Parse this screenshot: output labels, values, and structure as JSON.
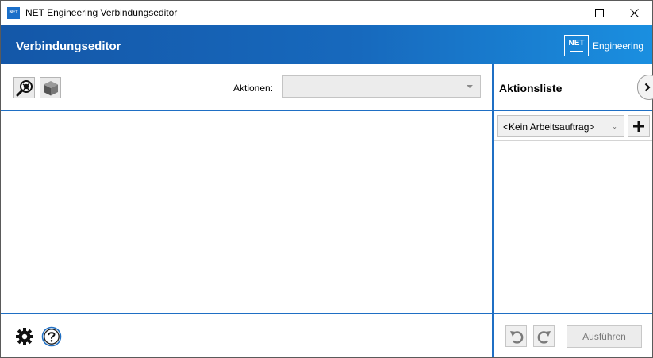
{
  "window": {
    "title": "NET Engineering Verbindungseditor",
    "icon_text": "NET",
    "controls": [
      "minimize-icon",
      "maximize-icon",
      "close-icon"
    ]
  },
  "header": {
    "title": "Verbindungseditor",
    "brand_mark": "NET",
    "brand_text": "Engineering",
    "gradient_colors": [
      "#1457a8",
      "#1a8fe0"
    ]
  },
  "toolbar": {
    "buttons": [
      {
        "icon": "network-search-icon"
      },
      {
        "icon": "cube-icon"
      }
    ],
    "actions_label": "Aktionen:",
    "actions_value": ""
  },
  "action_panel": {
    "title": "Aktionsliste",
    "toggle_icon": "chevron-right-icon",
    "work_order_value": "<Kein Arbeitsauftrag>",
    "add_icon": "plus-icon",
    "items": []
  },
  "footer": {
    "settings_icon": "gear-icon",
    "help_icon": "help-icon",
    "undo_icon": "undo-icon",
    "redo_icon": "redo-icon",
    "run_label": "Ausführen"
  },
  "colors": {
    "accent": "#1f6fc4",
    "disabled_text": "#7a7a7a"
  }
}
